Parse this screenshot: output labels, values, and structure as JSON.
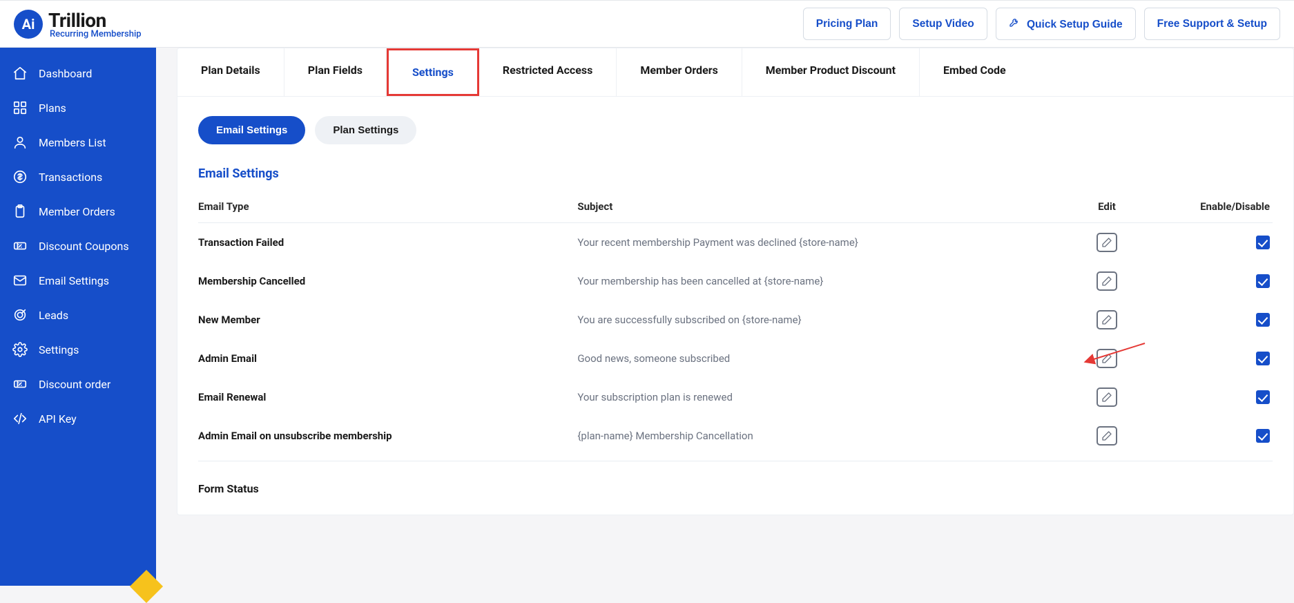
{
  "brand": {
    "badge": "Ai",
    "title": "Trillion",
    "subtitle": "Recurring Membership"
  },
  "topbar": {
    "pricing": "Pricing Plan",
    "setup_video": "Setup Video",
    "quick_guide": "Quick Setup Guide",
    "free_support": "Free Support & Setup"
  },
  "sidebar": {
    "items": [
      {
        "label": "Dashboard",
        "icon": "home"
      },
      {
        "label": "Plans",
        "icon": "grid"
      },
      {
        "label": "Members List",
        "icon": "user"
      },
      {
        "label": "Transactions",
        "icon": "dollar"
      },
      {
        "label": "Member Orders",
        "icon": "clipboard"
      },
      {
        "label": "Discount Coupons",
        "icon": "ticket"
      },
      {
        "label": "Email Settings",
        "icon": "mail"
      },
      {
        "label": "Leads",
        "icon": "target"
      },
      {
        "label": "Settings",
        "icon": "gear"
      },
      {
        "label": "Discount order",
        "icon": "ticket"
      },
      {
        "label": "API Key",
        "icon": "code"
      }
    ]
  },
  "tabs": {
    "items": [
      {
        "label": "Plan Details"
      },
      {
        "label": "Plan Fields"
      },
      {
        "label": "Settings",
        "active": true,
        "highlight": true
      },
      {
        "label": "Restricted Access"
      },
      {
        "label": "Member Orders"
      },
      {
        "label": "Member Product Discount"
      },
      {
        "label": "Embed Code"
      }
    ]
  },
  "pills": {
    "email": "Email Settings",
    "plan": "Plan Settings"
  },
  "section": {
    "title": "Email Settings"
  },
  "table": {
    "head": {
      "type": "Email Type",
      "subject": "Subject",
      "edit": "Edit",
      "enable": "Enable/Disable"
    },
    "rows": [
      {
        "type": "Transaction Failed",
        "subject": "Your recent membership Payment was declined {store-name}",
        "enabled": true
      },
      {
        "type": "Membership Cancelled",
        "subject": "Your membership has been cancelled at {store-name}",
        "enabled": true
      },
      {
        "type": "New Member",
        "subject": "You are successfully subscribed on {store-name}",
        "enabled": true
      },
      {
        "type": "Admin Email",
        "subject": "Good news, someone subscribed",
        "enabled": true,
        "arrow": true
      },
      {
        "type": "Email Renewal",
        "subject": "Your subscription plan is renewed",
        "enabled": true
      },
      {
        "type": "Admin Email on unsubscribe membership",
        "subject": "{plan-name} Membership Cancellation",
        "enabled": true
      }
    ]
  },
  "form_status": {
    "label": "Form Status"
  },
  "colors": {
    "brand": "#164ec9",
    "highlight": "#e53935",
    "arrow": "#e53935"
  }
}
